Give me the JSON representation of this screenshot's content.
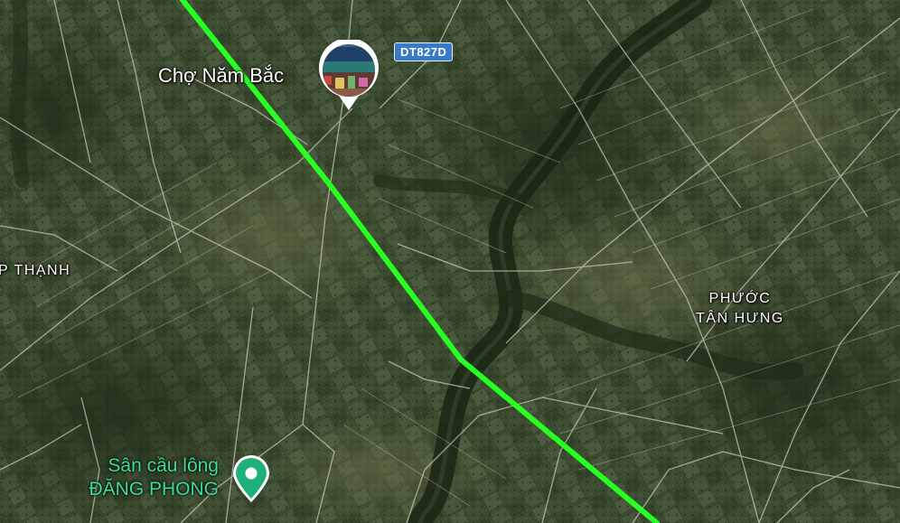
{
  "map": {
    "view": "satellite",
    "route_color": "#27ff23",
    "labels": {
      "market": "Chợ Năm Bắc",
      "area_left": "P THẠNH",
      "area_right_line1": "PHƯỚC",
      "area_right_line2": "TÂN HƯNG"
    },
    "road_shield": {
      "text": "DT827D",
      "color": "#3b79c9"
    },
    "poi": {
      "line1": "Sân cầu lông",
      "line2": "ĐĂNG PHONG",
      "color": "#3fdc9a",
      "icon": "map-pin-icon"
    },
    "photo_marker": {
      "icon": "market-photo-icon"
    }
  }
}
